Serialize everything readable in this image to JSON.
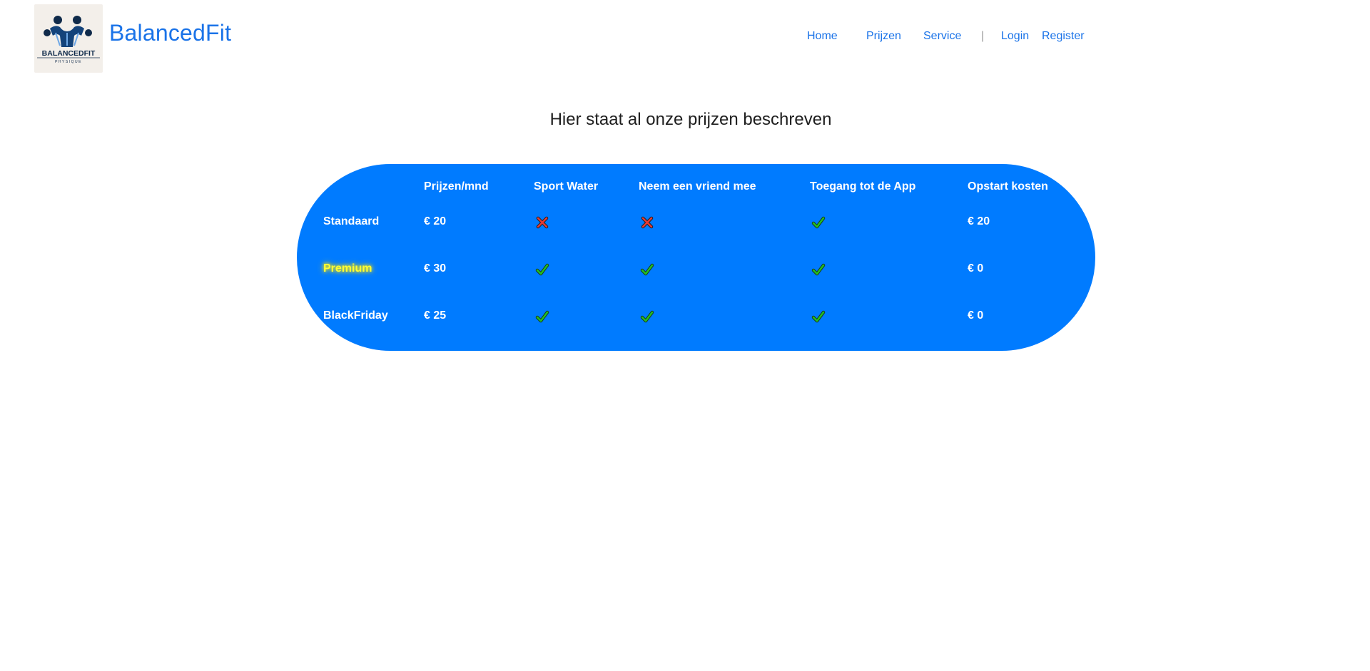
{
  "header": {
    "logo_text_main": "BALANCEDFIT",
    "logo_text_sub": "PHYSIQUE",
    "brand": "BalancedFit",
    "nav": {
      "home": "Home",
      "prijzen": "Prijzen",
      "service": "Service",
      "separator": "|",
      "login": "Login",
      "register": "Register"
    }
  },
  "main": {
    "title": "Hier staat al onze prijzen beschreven"
  },
  "pricing": {
    "columns": [
      "",
      "Prijzen/mnd",
      "Sport Water",
      "Neem een vriend mee",
      "Toegang tot de App",
      "Opstart kosten"
    ],
    "rows": [
      {
        "name": "Standaard",
        "price": "€ 20",
        "sport_water": "cross-icon",
        "vriend": "cross-icon",
        "app": "check-icon",
        "opstart": "€ 20"
      },
      {
        "name": "Premium",
        "price": "€ 30",
        "sport_water": "check-icon",
        "vriend": "check-icon",
        "app": "check-icon",
        "opstart": "€ 0"
      },
      {
        "name": "BlackFriday",
        "price": "€ 25",
        "sport_water": "check-icon",
        "vriend": "check-icon",
        "app": "check-icon",
        "opstart": "€ 0"
      }
    ]
  },
  "colors": {
    "brand_blue": "#1a73e8",
    "pill_blue": "#007bff",
    "premium_yellow": "#ffff33",
    "check_green": "#22c022",
    "cross_red": "#e53935"
  }
}
